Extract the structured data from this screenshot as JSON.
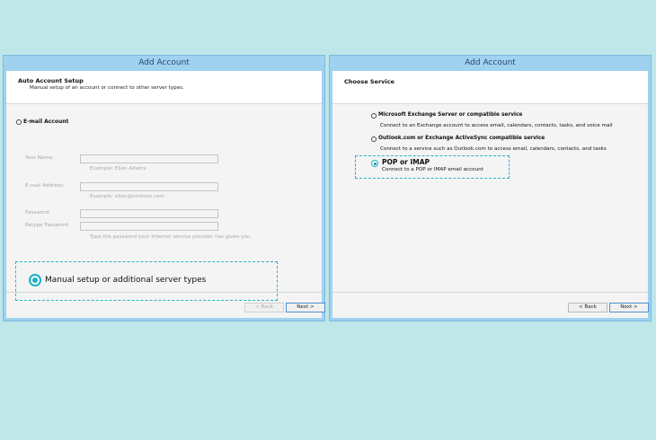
{
  "left_dialog": {
    "title": "Add Account",
    "header_title": "Auto Account Setup",
    "header_subtitle": "Manual setup of an account or connect to other server types.",
    "email_account_label": "E-mail Account",
    "your_name_label": "Your Name:",
    "your_name_value": "",
    "your_name_example": "Example: Ellen Adams",
    "email_address_label": "E-mail Address:",
    "email_address_value": "",
    "email_address_example": "Example: ellen@contoso.com",
    "password_label": "Password:",
    "retype_password_label": "Retype Password:",
    "password_hint": "Type the password your Internet service provider has given you.",
    "manual_setup_label": "Manual setup or additional server types",
    "back_button": "< Back",
    "next_button": "Next >"
  },
  "right_dialog": {
    "title": "Add Account",
    "header_title": "Choose Service",
    "options": [
      {
        "label": "Microsoft Exchange Server or compatible service",
        "description": "Connect to an Exchange account to access email, calendars, contacts, tasks, and voice mail",
        "selected": false
      },
      {
        "label": "Outlook.com or Exchange ActiveSync compatible service",
        "description": "Connect to a service such as Outlook.com to access email, calendars, contacts, and tasks",
        "selected": false
      },
      {
        "label": "POP or IMAP",
        "description": "Connect to a POP or IMAP email account",
        "selected": true
      }
    ],
    "back_button": "< Back",
    "next_button": "Next >"
  },
  "colors": {
    "highlight": "#24b3c7",
    "titlebar": "#9fd2f0",
    "background": "#bfe6e8"
  }
}
